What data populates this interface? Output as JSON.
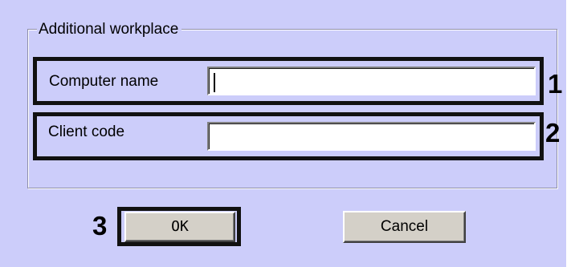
{
  "dialog": {
    "group_title": "Additional workplace",
    "fields": [
      {
        "label": "Computer name",
        "value": "",
        "marker": "1"
      },
      {
        "label": "Client code",
        "value": "",
        "marker": "2"
      }
    ],
    "ok_marker": "3",
    "ok_label": "OK",
    "cancel_label": "Cancel"
  },
  "colors": {
    "background": "#cccdfa",
    "highlight": "#111111",
    "button": "#d4d0c8"
  }
}
